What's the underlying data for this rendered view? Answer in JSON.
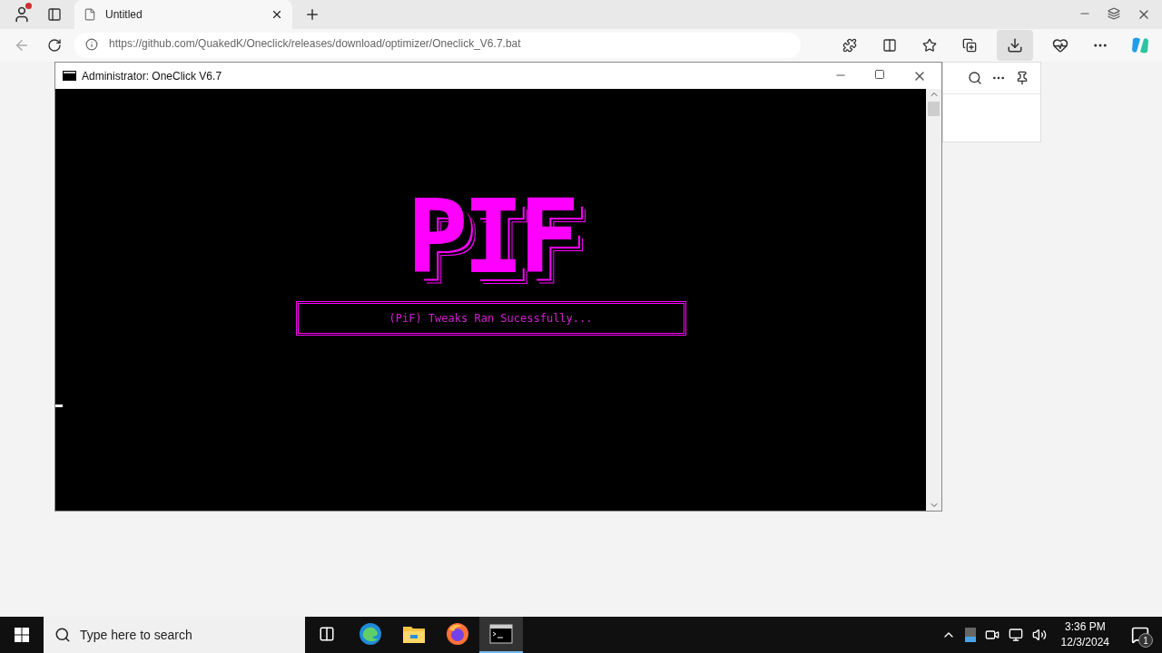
{
  "browser": {
    "tabs": [
      {
        "title": "Untitled",
        "selected": true
      }
    ],
    "address": "https://github.com/QuakedK/Oneclick/releases/download/optimizer/Oneclick_V6.7.bat"
  },
  "console": {
    "title": "Administrator:  OneClick V6.7",
    "logo": "PIF",
    "message": "(PiF) Tweaks Ran Sucessfully..."
  },
  "taskbar": {
    "search": {
      "placeholder": "Type here to search"
    },
    "apps": [
      {
        "kind": "edge",
        "selected": false
      },
      {
        "kind": "explorer",
        "selected": false
      },
      {
        "kind": "firefox",
        "selected": false
      },
      {
        "kind": "terminal",
        "selected": true
      }
    ],
    "time": "3:36 PM",
    "date": "12/3/2024",
    "notifications": "1"
  }
}
